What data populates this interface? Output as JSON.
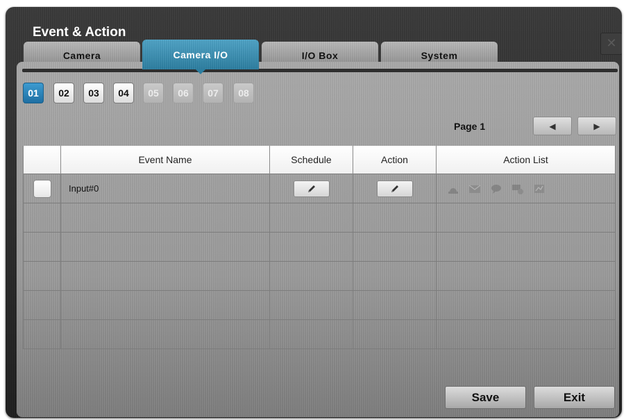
{
  "window": {
    "title": "Event & Action",
    "close_icon": "close-icon"
  },
  "tabs": [
    {
      "label": "Camera",
      "active": false
    },
    {
      "label": "Camera I/O",
      "active": true
    },
    {
      "label": "I/O Box",
      "active": false
    },
    {
      "label": "System",
      "active": false
    }
  ],
  "channels": [
    {
      "label": "01",
      "state": "selected"
    },
    {
      "label": "02",
      "state": "enabled"
    },
    {
      "label": "03",
      "state": "enabled"
    },
    {
      "label": "04",
      "state": "enabled"
    },
    {
      "label": "05",
      "state": "disabled"
    },
    {
      "label": "06",
      "state": "disabled"
    },
    {
      "label": "07",
      "state": "disabled"
    },
    {
      "label": "08",
      "state": "disabled"
    }
  ],
  "pager": {
    "label": "Page 1",
    "prev_icon": "triangle-left-icon",
    "next_icon": "triangle-right-icon"
  },
  "table": {
    "columns": [
      "",
      "Event Name",
      "Schedule",
      "Action",
      "Action List"
    ],
    "rows": [
      {
        "checked": false,
        "event_name": "Input#0",
        "schedule_icon": "pencil-icon",
        "action_icon": "pencil-icon",
        "action_list_icons": [
          "alarm-light-icon",
          "email-icon",
          "chat-icon",
          "camera-network-icon",
          "recording-icon"
        ]
      },
      {
        "checked": false,
        "event_name": ""
      },
      {
        "checked": false,
        "event_name": ""
      },
      {
        "checked": false,
        "event_name": ""
      },
      {
        "checked": false,
        "event_name": ""
      },
      {
        "checked": false,
        "event_name": ""
      }
    ]
  },
  "footer": {
    "save_label": "Save",
    "exit_label": "Exit"
  },
  "colors": {
    "accent": "#2c7ea0",
    "channel_selected": "#1e6fa3",
    "panel": "#a9a9a9",
    "window": "#2a2a2a"
  }
}
